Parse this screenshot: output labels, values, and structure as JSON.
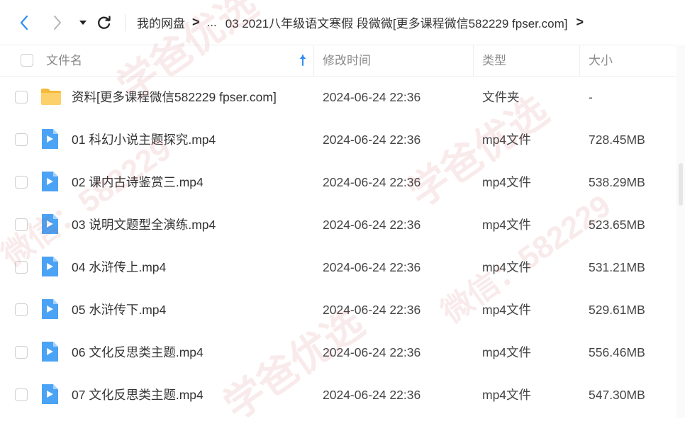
{
  "breadcrumb": {
    "root": "我的网盘",
    "ellipsis": "...",
    "current": "03 2021八年级语文寒假 段微微[更多课程微信582229 fpser.com]"
  },
  "columns": {
    "name": "文件名",
    "modified": "修改时间",
    "type": "类型",
    "size": "大小"
  },
  "files": [
    {
      "name": "资料[更多课程微信582229 fpser.com]",
      "modified": "2024-06-24 22:36",
      "type": "文件夹",
      "size": "-",
      "icon": "folder-icon"
    },
    {
      "name": "01 科幻小说主题探究.mp4",
      "modified": "2024-06-24 22:36",
      "type": "mp4文件",
      "size": "728.45MB",
      "icon": "video-file-icon"
    },
    {
      "name": "02 课内古诗鉴赏三.mp4",
      "modified": "2024-06-24 22:36",
      "type": "mp4文件",
      "size": "538.29MB",
      "icon": "video-file-icon"
    },
    {
      "name": "03 说明文题型全演练.mp4",
      "modified": "2024-06-24 22:36",
      "type": "mp4文件",
      "size": "523.65MB",
      "icon": "video-file-icon"
    },
    {
      "name": "04 水浒传上.mp4",
      "modified": "2024-06-24 22:36",
      "type": "mp4文件",
      "size": "531.21MB",
      "icon": "video-file-icon"
    },
    {
      "name": "05 水浒传下.mp4",
      "modified": "2024-06-24 22:36",
      "type": "mp4文件",
      "size": "529.61MB",
      "icon": "video-file-icon"
    },
    {
      "name": "06 文化反思类主题.mp4",
      "modified": "2024-06-24 22:36",
      "type": "mp4文件",
      "size": "556.46MB",
      "icon": "video-file-icon"
    },
    {
      "name": "07 文化反思类主题.mp4",
      "modified": "2024-06-24 22:36",
      "type": "mp4文件",
      "size": "547.30MB",
      "icon": "video-file-icon"
    }
  ],
  "watermark": {
    "line1": "学爸优选",
    "line2": "微信：582229"
  },
  "colors": {
    "accent": "#2f8ef4",
    "folder": "#f9c74f",
    "video": "#4aa3f5"
  }
}
